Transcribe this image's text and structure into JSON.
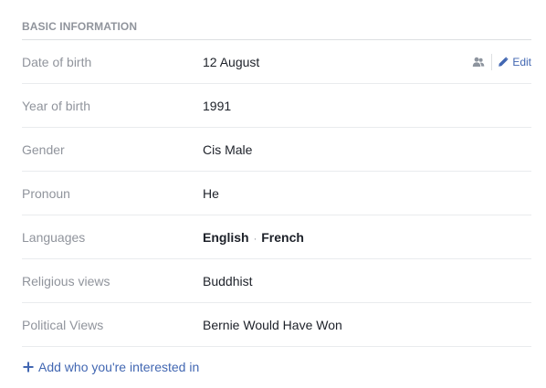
{
  "section": {
    "title": "BASIC INFORMATION"
  },
  "rows": [
    {
      "label": "Date of birth",
      "value": "12 August"
    },
    {
      "label": "Year of birth",
      "value": "1991"
    },
    {
      "label": "Gender",
      "value": "Cis Male"
    },
    {
      "label": "Pronoun",
      "value": "He"
    },
    {
      "label": "Languages",
      "languages": [
        "English",
        "French"
      ],
      "separator": "·"
    },
    {
      "label": "Religious views",
      "value": "Buddhist"
    },
    {
      "label": "Political Views",
      "value": "Bernie Would Have Won"
    }
  ],
  "actions": {
    "audience_icon": "friends-audience-icon",
    "edit_label": "Edit",
    "edit_icon": "pencil-icon"
  },
  "add_interest": {
    "label": "Add who you're interested in",
    "icon": "plus-icon"
  },
  "colors": {
    "link": "#4267b2",
    "label": "#90949c",
    "value": "#1d2129",
    "divider": "#e9ebee"
  }
}
